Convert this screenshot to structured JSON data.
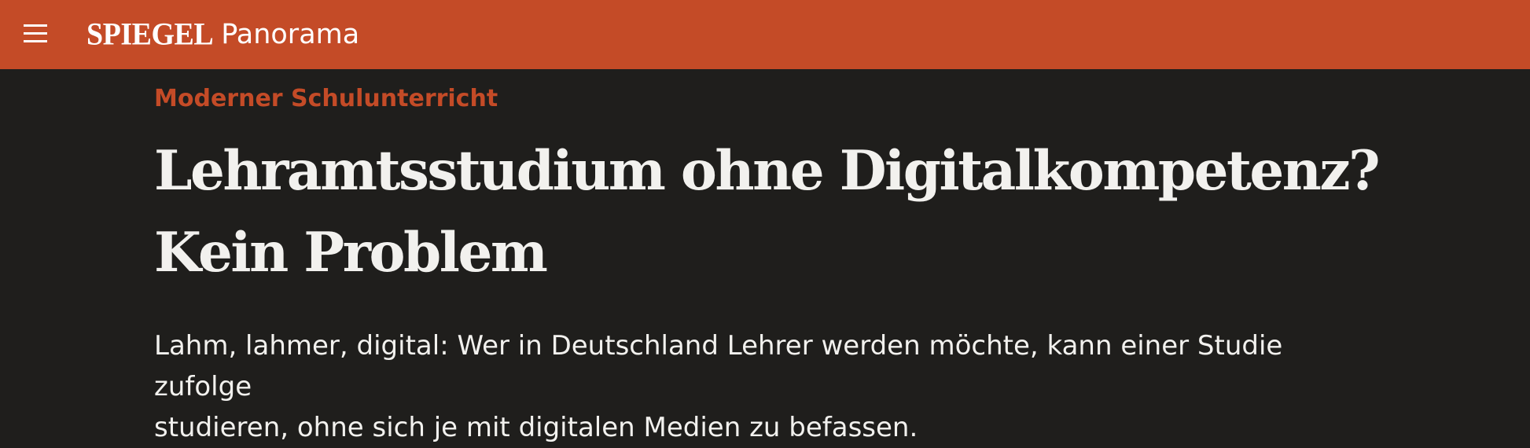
{
  "header": {
    "menu_icon": "hamburger-menu-icon",
    "logo_text": "SPIEGEL",
    "section_label": "Panorama",
    "background_color": "#c44b27"
  },
  "article": {
    "kicker": "Moderner Schulunterricht",
    "headline_line1": "Lehramtsstudium ohne Digitalkompetenz?",
    "headline_line2": "Kein Problem",
    "lead_line1": "Lahm, lahmer, digital: Wer in Deutschland Lehrer werden möchte, kann einer Studie zufolge",
    "lead_line2": "studieren, ohne sich je mit digitalen Medien zu befassen.",
    "kicker_color": "#c44b27",
    "background_color": "#1f1e1c",
    "text_color": "#f2f1ee"
  }
}
